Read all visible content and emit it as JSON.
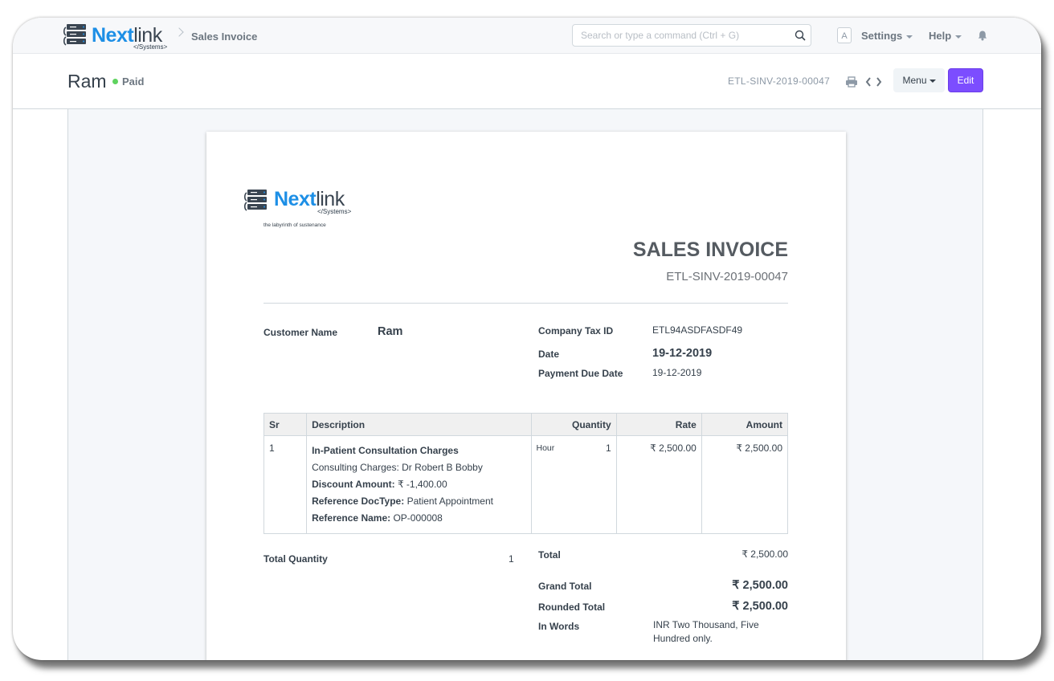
{
  "navbar": {
    "brand_a": "Next",
    "brand_b": "link",
    "brand_sub": "</Systems>",
    "breadcrumb": "Sales Invoice",
    "search_placeholder": "Search or type a command (Ctrl + G)",
    "avatar_letter": "A",
    "settings": "Settings",
    "help": "Help"
  },
  "page_head": {
    "title": "Ram",
    "status": "Paid",
    "doc_name": "ETL-SINV-2019-00047",
    "menu_label": "Menu",
    "edit_label": "Edit"
  },
  "invoice": {
    "logo_a": "Next",
    "logo_b": "link",
    "logo_sub": "</Systems>",
    "tagline": "the labyrinth of sustenance",
    "heading": "SALES INVOICE",
    "number": "ETL-SINV-2019-00047",
    "fields": {
      "customer_name_label": "Customer Name",
      "customer_name": "Ram",
      "tax_id_label": "Company Tax ID",
      "tax_id": "ETL94ASDFASDF49",
      "date_label": "Date",
      "date": "19-12-2019",
      "due_label": "Payment Due Date",
      "due": "19-12-2019"
    },
    "table": {
      "headers": [
        "Sr",
        "Description",
        "Quantity",
        "Rate",
        "Amount"
      ],
      "rows": [
        {
          "sr": "1",
          "item": "In-Patient Consultation Charges",
          "desc": "Consulting Charges: Dr Robert B Bobby",
          "discount_label": "Discount Amount:",
          "discount": " ₹ -1,400.00",
          "ref_doctype_label": "Reference DocType:",
          "ref_doctype": " Patient Appointment",
          "ref_name_label": "Reference Name:",
          "ref_name": " OP-000008",
          "uom": "Hour",
          "qty": "1",
          "rate": "₹ 2,500.00",
          "amount": "₹ 2,500.00"
        }
      ]
    },
    "totals": {
      "total_qty_label": "Total Quantity",
      "total_qty": "1",
      "total_label": "Total",
      "total": "₹ 2,500.00",
      "grand_total_label": "Grand Total",
      "grand_total": "₹ 2,500.00",
      "rounded_total_label": "Rounded Total",
      "rounded_total": "₹ 2,500.00",
      "in_words_label": "In Words",
      "in_words": "INR Two Thousand, Five Hundred only."
    }
  },
  "colors": {
    "accent": "#7c4dff",
    "brand_blue": "#1d8fe6",
    "status_green": "#5fd35f"
  },
  "icons": [
    "server-logo-icon",
    "search-icon",
    "bell-icon",
    "printer-icon",
    "chevron-left-icon",
    "chevron-right-icon"
  ]
}
